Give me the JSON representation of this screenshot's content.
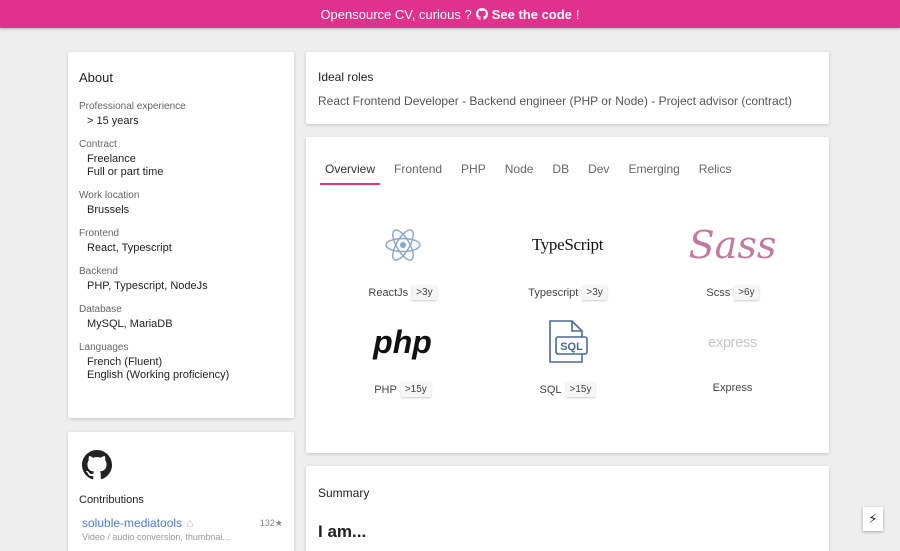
{
  "banner": {
    "prefix": "Opensource CV, curious ?",
    "link": "See the code",
    "suffix": "!"
  },
  "about": {
    "title": "About",
    "groups": [
      {
        "label": "Professional experience",
        "values": [
          "> 15 years"
        ]
      },
      {
        "label": "Contract",
        "values": [
          "Freelance",
          "Full or part time"
        ]
      },
      {
        "label": "Work location",
        "values": [
          "Brussels"
        ]
      },
      {
        "label": "Frontend",
        "values": [
          "React, Typescript"
        ]
      },
      {
        "label": "Backend",
        "values": [
          "PHP, Typescript, NodeJs"
        ]
      },
      {
        "label": "Database",
        "values": [
          "MySQL, MariaDB"
        ]
      },
      {
        "label": "Languages",
        "values": [
          "French (Fluent)",
          "English (Working proficiency)"
        ]
      }
    ]
  },
  "contributions": {
    "title": "Contributions",
    "repos": [
      {
        "name": "soluble-mediatools",
        "stars": "132",
        "desc": "Video / audio conversion, thumbnai..."
      }
    ]
  },
  "roles": {
    "title": "Ideal roles",
    "text": "React Frontend Developer - Backend engineer (PHP or Node) - Project advisor (contract)"
  },
  "skills": {
    "tabs": [
      "Overview",
      "Frontend",
      "PHP",
      "Node",
      "DB",
      "Dev",
      "Emerging",
      "Relics"
    ],
    "active_tab": "Overview",
    "items": [
      {
        "name": "ReactJs",
        "years": ">3y",
        "logo": "react-icon"
      },
      {
        "name": "Typescript",
        "years": ">3y",
        "logo": "typescript-icon",
        "logo_text": "TypeScript"
      },
      {
        "name": "Scss",
        "years": ">6y",
        "logo": "sass-icon",
        "logo_text": "Sass"
      },
      {
        "name": "PHP",
        "years": ">15y",
        "logo": "php-icon",
        "logo_text": "php"
      },
      {
        "name": "SQL",
        "years": ">15y",
        "logo": "sql-icon",
        "logo_text": "SQL"
      },
      {
        "name": "Express",
        "years": "",
        "logo": "express-icon",
        "logo_text": "express"
      }
    ]
  },
  "summary": {
    "title": "Summary",
    "heading": "I am..."
  },
  "colors": {
    "accent": "#e0318f",
    "react": "#8aa4c8",
    "sass": "#c27ba0",
    "sql": "#4a6a94"
  }
}
